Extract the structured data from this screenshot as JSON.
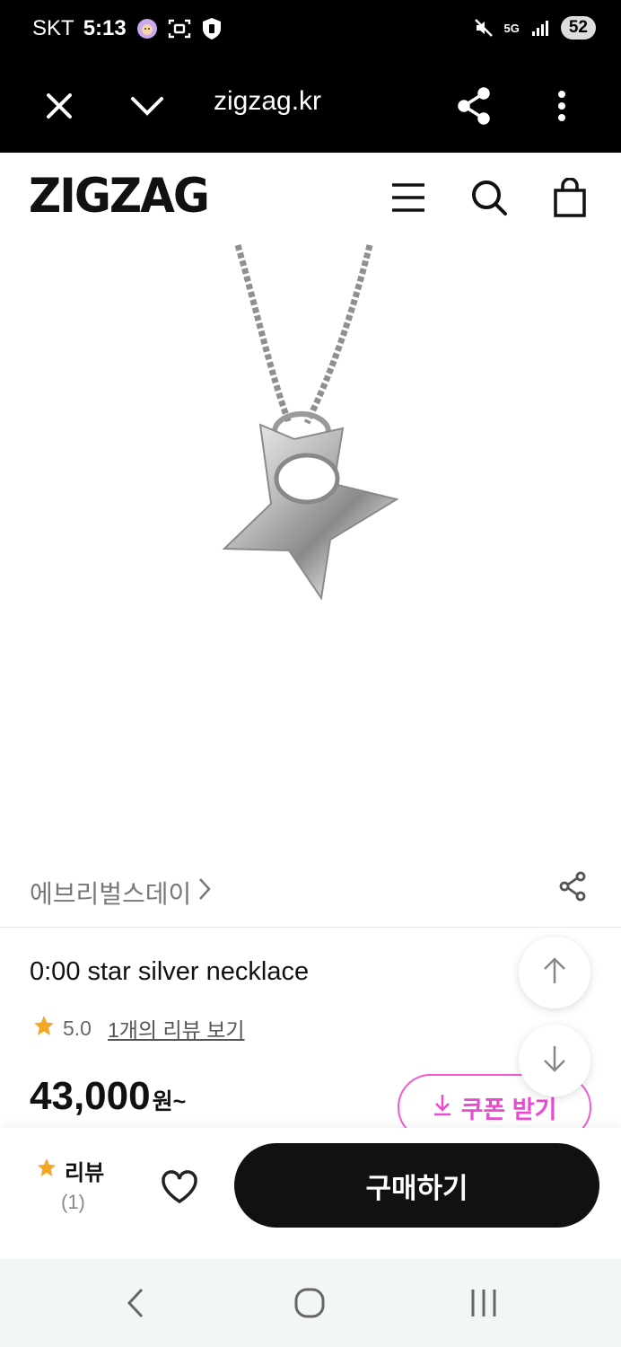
{
  "status_bar": {
    "carrier": "SKT",
    "time": "5:13",
    "network": "5G",
    "battery": "52",
    "icons": [
      "face-emoji-icon",
      "screen-capture-icon",
      "shield-icon",
      "mute-icon",
      "signal-icon"
    ]
  },
  "browser": {
    "url": "zigzag.kr",
    "icons": [
      "close-icon",
      "chevron-down-icon",
      "share-icon",
      "more-vertical-icon"
    ]
  },
  "site": {
    "logo": "ZIGZAG",
    "icons": [
      "menu-icon",
      "search-icon",
      "shopping-bag-icon"
    ]
  },
  "product": {
    "image_icon": "star-necklace-image",
    "brand": "에브리벌스데이",
    "title": "0:00 star silver necklace",
    "rating": "5.0",
    "review_link": "1개의 리뷰 보기",
    "price": "43,000",
    "price_unit": "원~",
    "coupon_label": "쿠폰 받기"
  },
  "bottom_bar": {
    "review_label": "리뷰",
    "review_count": "(1)",
    "buy_label": "구매하기"
  },
  "colors": {
    "coupon_accent": "#e84bd0",
    "star": "#f5a623",
    "dark": "#111111"
  }
}
